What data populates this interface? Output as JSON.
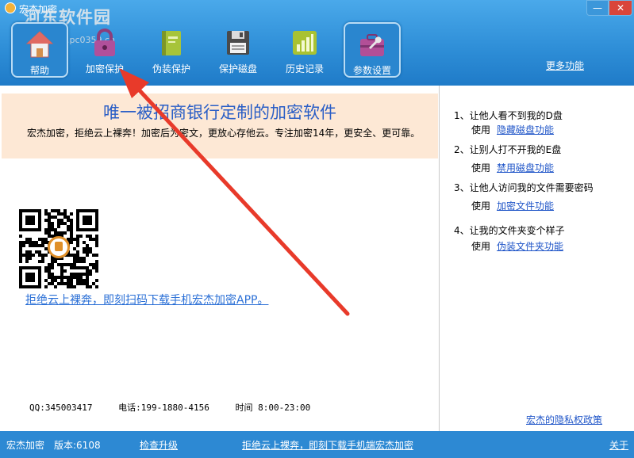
{
  "window": {
    "title": "宏杰加密",
    "minimize_label": "—",
    "close_label": "✕"
  },
  "watermark": {
    "site_name": "河东软件园",
    "site_url": "www.pc0359.cn"
  },
  "toolbar": {
    "items": [
      {
        "label": "帮助",
        "icon": "house-icon",
        "active": true
      },
      {
        "label": "加密保护",
        "icon": "padlock-icon",
        "active": false
      },
      {
        "label": "伪装保护",
        "icon": "book-icon",
        "active": false
      },
      {
        "label": "保护磁盘",
        "icon": "floppy-disk-icon",
        "active": false
      },
      {
        "label": "历史记录",
        "icon": "bar-chart-icon",
        "active": false
      },
      {
        "label": "参数设置",
        "icon": "toolbox-icon",
        "active": true
      }
    ],
    "more_link": "更多功能"
  },
  "banner": {
    "title": "唯一被招商银行定制的加密软件",
    "description": "宏杰加密，拒绝云上裸奔！加密后为密文，更放心存他云。专注加密14年，更安全、更可靠。"
  },
  "qr": {
    "link_text": "拒绝云上裸奔，即刻扫码下载手机宏杰加密APP。"
  },
  "contact": {
    "qq": "QQ:345003417",
    "phone": "电话:199-1880-4156",
    "hours": "时间 8:00-23:00"
  },
  "side_panel": {
    "tips": [
      {
        "title": "1、让他人看不到我的D盘",
        "use": "使用",
        "link": "隐藏磁盘功能"
      },
      {
        "title": "2、让别人打不开我的E盘",
        "use": "使用",
        "link": "禁用磁盘功能"
      },
      {
        "title": "3、让他人访问我的文件需要密码",
        "use": "使用",
        "link": "加密文件功能"
      },
      {
        "title": "4、让我的文件夹变个样子",
        "use": "使用",
        "link": "伪装文件夹功能"
      }
    ],
    "privacy_link": "宏杰的隐私权政策"
  },
  "statusbar": {
    "app_name": "宏杰加密",
    "version": "版本:6108",
    "check_update": "检查升级",
    "promo": "拒绝云上裸奔，即刻下载手机端宏杰加密",
    "about": "关于"
  },
  "colors": {
    "toolbar_blue": "#2f8fd8",
    "banner_bg": "#fde8d5",
    "banner_title": "#2a5ec6",
    "link_blue": "#1f55c8",
    "arrow_red": "#e83a2a"
  }
}
